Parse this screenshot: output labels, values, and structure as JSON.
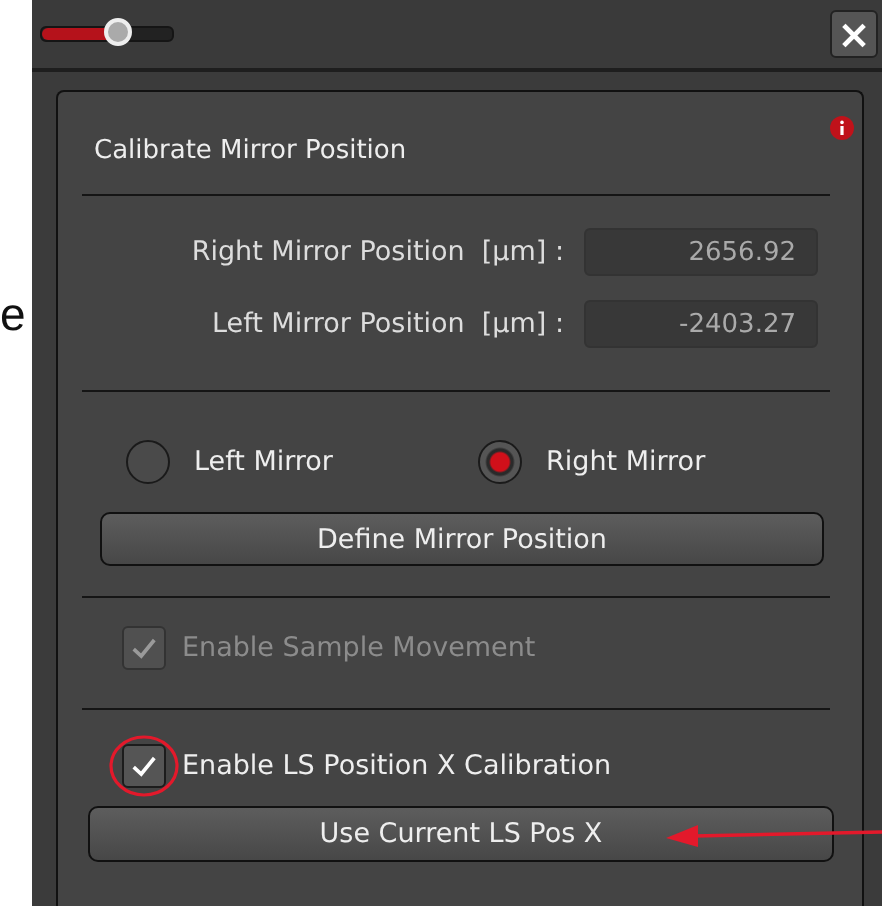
{
  "backdrop_text": "e",
  "toolbar": {
    "slider": {
      "level": 0.58
    },
    "close": "×"
  },
  "panel": {
    "title": "Calibrate Mirror Position",
    "fields": [
      {
        "label": "Right Mirror Position  [µm] :",
        "value": "2656.92"
      },
      {
        "label": "Left Mirror Position  [µm] :",
        "value": "-2403.27"
      }
    ],
    "radios": [
      {
        "label": "Left Mirror",
        "selected": false
      },
      {
        "label": "Right Mirror",
        "selected": true
      }
    ],
    "define_button": "Define Mirror Position",
    "checkboxes": [
      {
        "label": "Enable Sample Movement",
        "checked": true,
        "disabled": true
      },
      {
        "label": "Enable LS Position X Calibration",
        "checked": true,
        "disabled": false
      }
    ],
    "use_button": "Use Current LS Pos X"
  },
  "annotations": {
    "checkbox_ring": true,
    "button_arrow": true
  }
}
